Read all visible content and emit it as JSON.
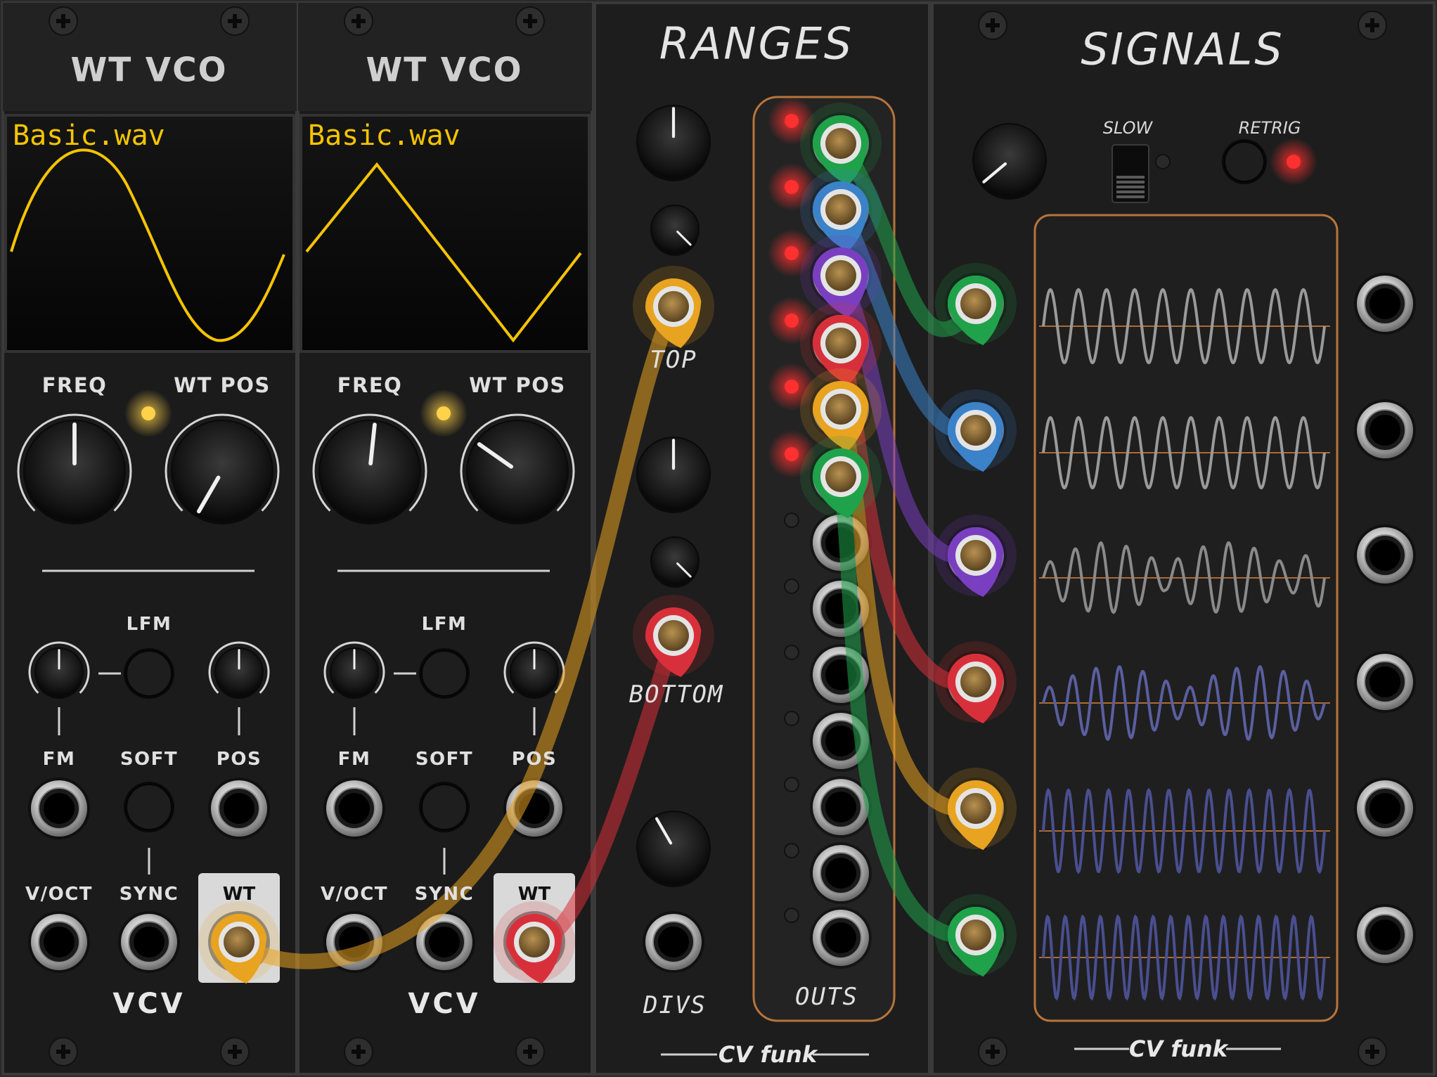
{
  "modules": {
    "vco1": {
      "title": "WT VCO",
      "wavetable": "Basic.wav",
      "freq_label": "FREQ",
      "wtpos_label": "WT POS",
      "lfm_label": "LFM",
      "fm_label": "FM",
      "soft_label": "SOFT",
      "pos_label": "POS",
      "voct_label": "V/OCT",
      "sync_label": "SYNC",
      "wt_label": "WT",
      "brand": "VCV"
    },
    "vco2": {
      "title": "WT VCO",
      "wavetable": "Basic.wav",
      "freq_label": "FREQ",
      "wtpos_label": "WT POS",
      "lfm_label": "LFM",
      "fm_label": "FM",
      "soft_label": "SOFT",
      "pos_label": "POS",
      "voct_label": "V/OCT",
      "sync_label": "SYNC",
      "wt_label": "WT",
      "brand": "VCV"
    },
    "ranges": {
      "title": "RANGES",
      "top_label": "TOP",
      "bottom_label": "BOTTOM",
      "divs_label": "DIVS",
      "outs_label": "OUTS",
      "brand": "CV funk"
    },
    "signals": {
      "title": "SIGNALS",
      "slow_label": "SLOW",
      "retrig_label": "RETRIG",
      "brand": "CV funk"
    }
  },
  "colors": {
    "panel": "#1b1b1b",
    "display_trace": "#f5c400",
    "cable_yellow": "#e8a320",
    "cable_red": "#d8303a",
    "cable_green": "#1fa24a",
    "cable_blue": "#3b82c9",
    "cable_purple": "#7a3fc0",
    "led_red": "#ff3030",
    "led_yellow": "#ffd24a",
    "scope_frame": "#b8743a"
  },
  "icons": [
    "screw-icon",
    "knob-icon",
    "jack-icon",
    "led-icon",
    "switch-icon",
    "push-button-icon"
  ]
}
